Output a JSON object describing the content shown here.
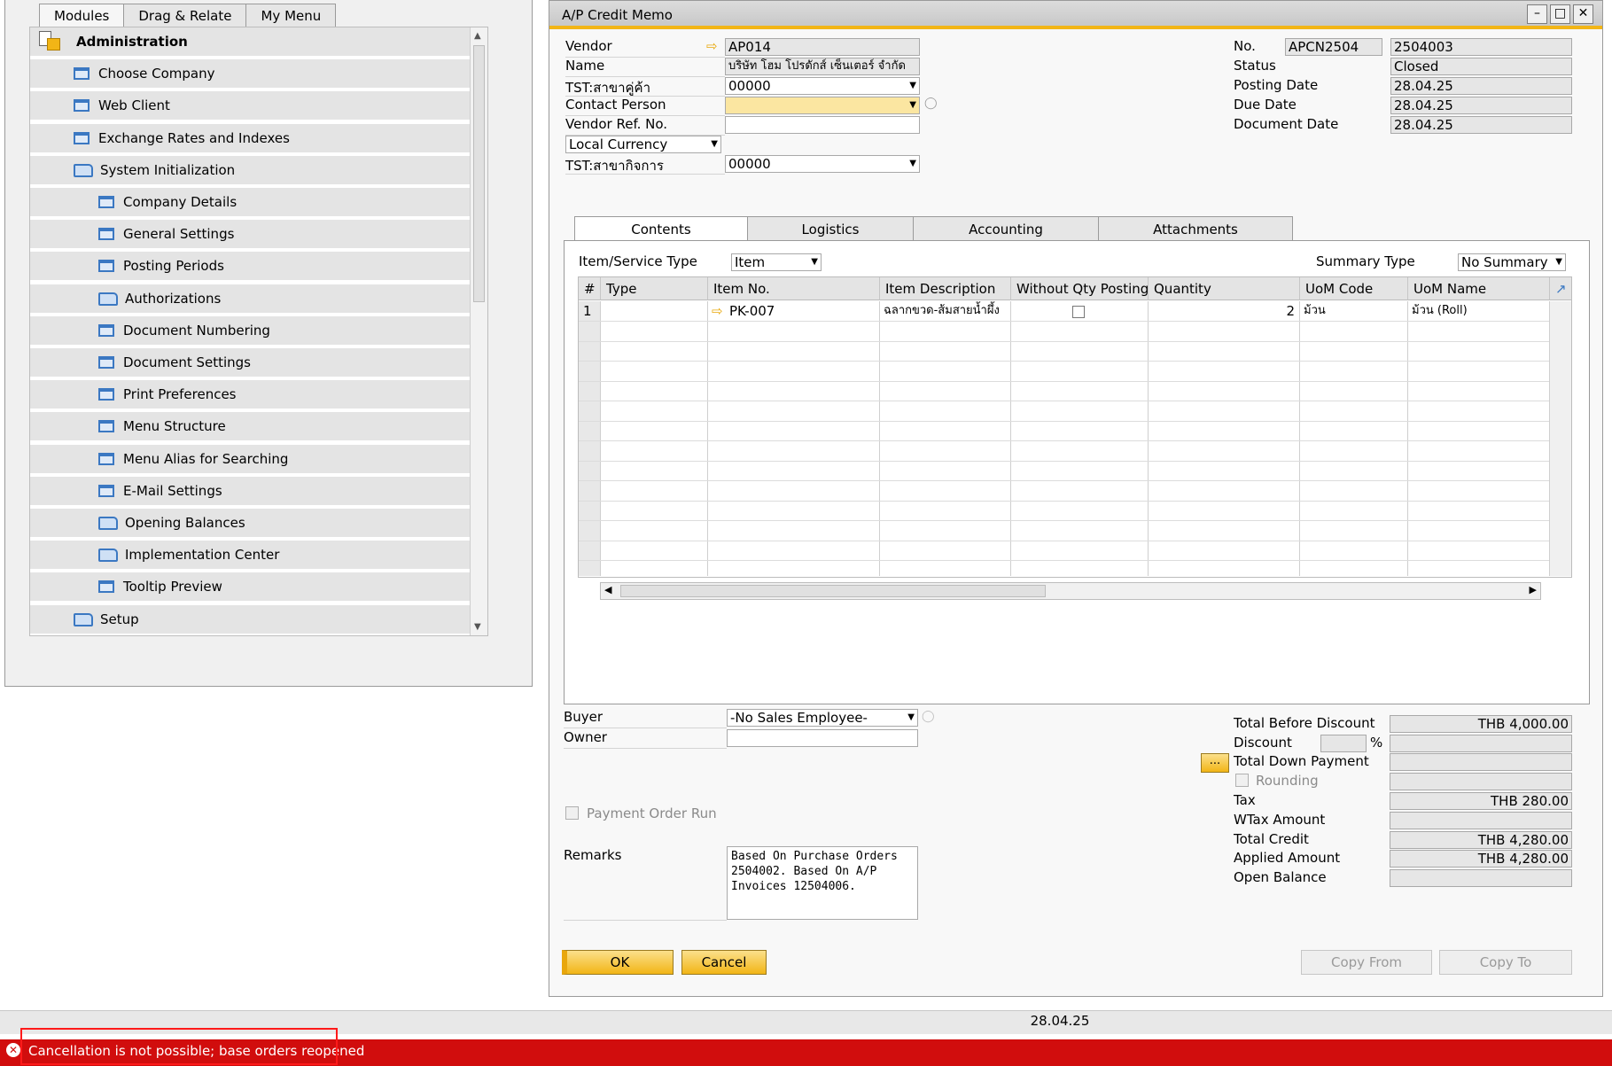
{
  "left_tabs": [
    "Modules",
    "Drag & Relate",
    "My Menu"
  ],
  "tree": {
    "root": "Administration",
    "items": [
      {
        "label": "Choose Company",
        "level": 1,
        "icon": "form-icon"
      },
      {
        "label": "Web Client",
        "level": 1,
        "icon": "form-icon"
      },
      {
        "label": "Exchange Rates and Indexes",
        "level": 1,
        "icon": "form-icon"
      },
      {
        "label": "System Initialization",
        "level": 1,
        "icon": "folder-open-icon"
      },
      {
        "label": "Company Details",
        "level": 2,
        "icon": "form-icon"
      },
      {
        "label": "General Settings",
        "level": 2,
        "icon": "form-icon"
      },
      {
        "label": "Posting Periods",
        "level": 2,
        "icon": "form-icon"
      },
      {
        "label": "Authorizations",
        "level": 2,
        "icon": "folder-icon"
      },
      {
        "label": "Document Numbering",
        "level": 2,
        "icon": "form-icon"
      },
      {
        "label": "Document Settings",
        "level": 2,
        "icon": "form-icon"
      },
      {
        "label": "Print Preferences",
        "level": 2,
        "icon": "form-icon"
      },
      {
        "label": "Menu Structure",
        "level": 2,
        "icon": "form-icon"
      },
      {
        "label": "Menu Alias for Searching",
        "level": 2,
        "icon": "form-icon"
      },
      {
        "label": "E-Mail Settings",
        "level": 2,
        "icon": "form-icon"
      },
      {
        "label": "Opening Balances",
        "level": 2,
        "icon": "folder-icon"
      },
      {
        "label": "Implementation Center",
        "level": 2,
        "icon": "folder-icon"
      },
      {
        "label": "Tooltip Preview",
        "level": 2,
        "icon": "form-icon"
      },
      {
        "label": "Setup",
        "level": 1,
        "icon": "folder-icon"
      }
    ]
  },
  "memo": {
    "title": "A/P Credit Memo",
    "header_left": {
      "vendor_label": "Vendor",
      "vendor_value": "AP014",
      "name_label": "Name",
      "name_value": "บริษัท โฮม โปรดักส์ เซ็นเตอร์ จำกัด",
      "branch_label": "TST:สาขาคู่ค้า",
      "branch_value": "00000",
      "contact_label": "Contact Person",
      "contact_value": "",
      "ref_label": "Vendor Ref. No.",
      "ref_value": "",
      "currency_value": "Local Currency",
      "biz_branch_label": "TST:สาขากิจการ",
      "biz_branch_value": "00000"
    },
    "header_right": {
      "no_label": "No.",
      "series_value": "APCN2504",
      "no_value": "2504003",
      "status_label": "Status",
      "status_value": "Closed",
      "posting_label": "Posting Date",
      "posting_value": "28.04.25",
      "due_label": "Due Date",
      "due_value": "28.04.25",
      "doc_label": "Document Date",
      "doc_value": "28.04.25"
    },
    "tabs": [
      "Contents",
      "Logistics",
      "Accounting",
      "Attachments"
    ],
    "item_type_label": "Item/Service Type",
    "item_type_value": "Item",
    "summary_label": "Summary Type",
    "summary_value": "No Summary",
    "grid": {
      "headers": [
        "#",
        "Type",
        "Item No.",
        "Item Description",
        "Without Qty Posting",
        "Quantity",
        "UoM Code",
        "UoM Name"
      ],
      "rows": [
        {
          "num": "1",
          "type": "",
          "item_no": "PK-007",
          "desc": "ฉลากขวด-ส้มสายน้ำผึ้ง",
          "without_qty": false,
          "qty": "2",
          "uom_code": "ม้วน",
          "uom_name": "ม้วน (Roll)"
        }
      ]
    },
    "footer_left": {
      "buyer_label": "Buyer",
      "buyer_value": "-No Sales Employee-",
      "owner_label": "Owner",
      "owner_value": "",
      "payment_run_label": "Payment Order Run",
      "remarks_label": "Remarks",
      "remarks_value": "Based On Purchase Orders 2504002. Based On A/P Invoices 12504006."
    },
    "totals": {
      "before_discount_label": "Total Before Discount",
      "before_discount_value": "THB 4,000.00",
      "discount_label": "Discount",
      "discount_pct": "%",
      "discount_value": "",
      "down_payment_label": "Total Down Payment",
      "down_payment_value": "",
      "rounding_label": "Rounding",
      "rounding_value": "",
      "tax_label": "Tax",
      "tax_value": "THB 280.00",
      "wtax_label": "WTax Amount",
      "wtax_value": "",
      "total_credit_label": "Total Credit",
      "total_credit_value": "THB 4,280.00",
      "applied_label": "Applied Amount",
      "applied_value": "THB 4,280.00",
      "open_balance_label": "Open Balance",
      "open_balance_value": ""
    },
    "buttons": {
      "ok": "OK",
      "cancel": "Cancel",
      "copy_from": "Copy From",
      "copy_to": "Copy To",
      "more": "..."
    }
  },
  "status_bar": {
    "date": "28.04.25",
    "error_message": "Cancellation is not possible; base orders reopened"
  },
  "colors": {
    "accent": "#f2b516",
    "error": "#d10d0d",
    "icon_blue": "#3b78c2"
  }
}
